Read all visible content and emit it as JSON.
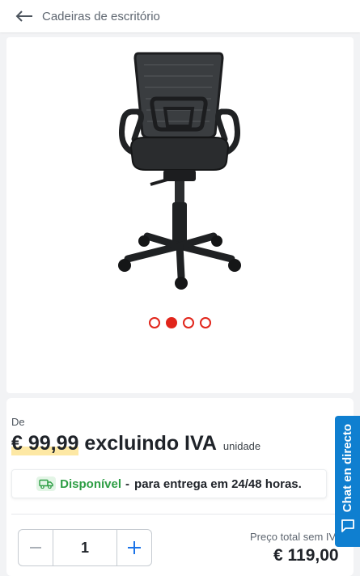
{
  "header": {
    "title": "Cadeiras de escritório"
  },
  "gallery": {
    "dots": [
      {
        "active": false
      },
      {
        "active": true
      },
      {
        "active": false
      },
      {
        "active": false
      }
    ],
    "image_alt": "office-chair"
  },
  "price": {
    "from_label": "De",
    "amount": "€ 99,99",
    "vat_label": "excluindo IVA",
    "unit_label": "unidade"
  },
  "availability": {
    "status": "Disponível",
    "separator": "-",
    "delivery": "para entrega em 24/48 horas."
  },
  "quantity": {
    "value": "1"
  },
  "total": {
    "label": "Preço total sem IVA",
    "value": "€ 119,00"
  },
  "chat": {
    "label": "Chat en directo"
  },
  "colors": {
    "accent_red": "#e1251b",
    "available_green": "#2e9e45",
    "chat_blue": "#0f7fd0",
    "stepper_blue": "#1a73e8"
  }
}
